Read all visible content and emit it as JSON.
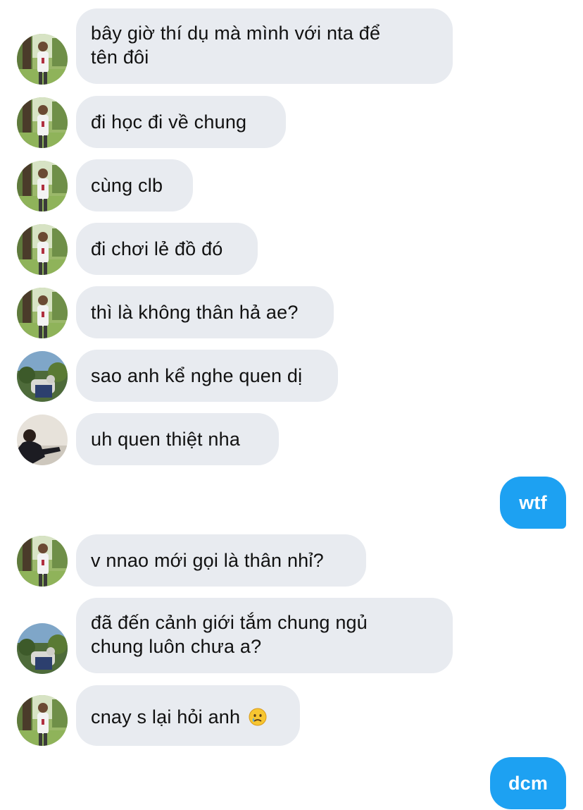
{
  "messages": [
    {
      "sender": "user-a",
      "text": "bây giờ thí dụ mà mình với nta để tên đôi",
      "line1": "bây giờ thí dụ mà mình với nta để",
      "line2": "tên đôi"
    },
    {
      "sender": "user-a",
      "text": "đi học đi về chung"
    },
    {
      "sender": "user-a",
      "text": "cùng clb"
    },
    {
      "sender": "user-a",
      "text": "đi chơi lẻ đồ đó"
    },
    {
      "sender": "user-a",
      "text": "thì là không thân hả ae?"
    },
    {
      "sender": "user-b",
      "text": "sao anh kể nghe quen dị"
    },
    {
      "sender": "user-c",
      "text": "uh quen thiệt nha"
    },
    {
      "sender": "me",
      "text": "wtf"
    },
    {
      "sender": "user-a",
      "text": "v nnao mới gọi là thân nhỉ?"
    },
    {
      "sender": "user-b",
      "text": "đã đến cảnh giới tắm chung ngủ chung luôn chưa a?",
      "line1": "đã đến cảnh giới tắm chung ngủ",
      "line2": "chung luôn chưa a?"
    },
    {
      "sender": "user-a",
      "text": "cnay s lại hỏi anh",
      "emoji": "crying-face-emoji"
    },
    {
      "sender": "me",
      "text": "dcm"
    }
  ],
  "colors": {
    "incoming_bubble": "#e8ebf0",
    "outgoing_bubble": "#1da1f2",
    "incoming_text": "#111111",
    "outgoing_text": "#ffffff"
  }
}
